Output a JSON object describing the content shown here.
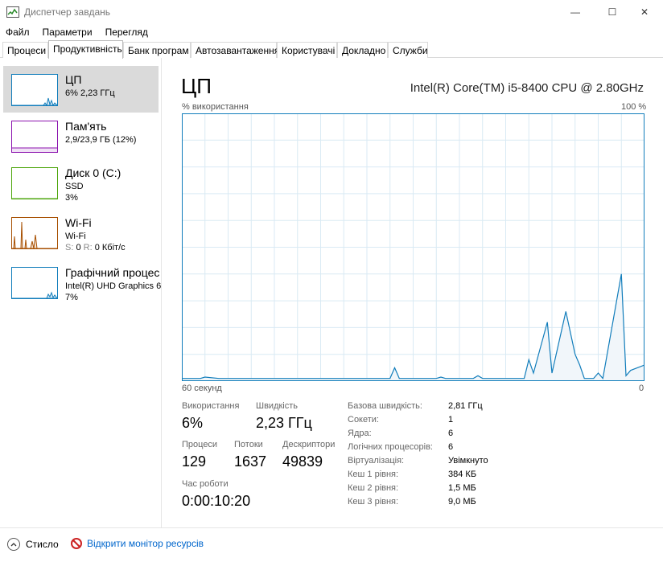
{
  "window": {
    "title": "Диспетчер завдань",
    "min_glyph": "—",
    "max_glyph": "☐",
    "close_glyph": "✕"
  },
  "menu": [
    "Файл",
    "Параметри",
    "Перегляд"
  ],
  "tabs": [
    "Процеси",
    "Продуктивність",
    "Банк програм",
    "Автозавантаження",
    "Користувачі",
    "Докладно",
    "Служби"
  ],
  "active_tab": "Продуктивність",
  "sidebar": {
    "items": [
      {
        "name": "cpu",
        "title": "ЦП",
        "sub1": "6% 2,23 ГГц",
        "sub2": "",
        "color": "#117dbb",
        "fill": "#f1f6fa"
      },
      {
        "name": "memory",
        "title": "Пам'ять",
        "sub1": "2,9/23,9 ГБ (12%)",
        "sub2": "",
        "color": "#8b12ae",
        "fill": "#f6eef9"
      },
      {
        "name": "disk",
        "title": "Диск 0 (C:)",
        "sub1": "SSD",
        "sub2": "3%",
        "color": "#4da60c",
        "fill": "#eff7e9"
      },
      {
        "name": "wifi",
        "title": "Wi-Fi",
        "sub1": "Wi-Fi",
        "sub2_s": "S:",
        "sub2_s_val": "0",
        "sub2_r": "R:",
        "sub2_r_val": "0 Кбіт/с",
        "color": "#a74f01",
        "fill": "#fcf3eb"
      },
      {
        "name": "gpu",
        "title": "Графічний процес",
        "sub1": "Intel(R) UHD Graphics 6",
        "sub2": "7%",
        "color": "#117dbb",
        "fill": "#f1f6fa"
      }
    ]
  },
  "main": {
    "title": "ЦП",
    "cpu_name": "Intel(R) Core(TM) i5-8400 CPU @ 2.80GHz",
    "y_label": "% використання",
    "y_max_label": "100 %",
    "x_left_label": "60 секунд",
    "x_right_label": "0"
  },
  "chart_data": {
    "type": "area",
    "ylim": [
      0,
      100
    ],
    "grid": true,
    "color": "#117dbb",
    "fill": "#f1f6fa",
    "series": [
      {
        "values": [
          0,
          0,
          0,
          0,
          0,
          0,
          0,
          0,
          0,
          0,
          0,
          0,
          0,
          0,
          0,
          0,
          0,
          0,
          0,
          0,
          0,
          0,
          0,
          0,
          0,
          0,
          0,
          0,
          0,
          0,
          0,
          0,
          0,
          0,
          0,
          0,
          0,
          0,
          0,
          0,
          0,
          0,
          0,
          0,
          0,
          0,
          0,
          0,
          0,
          0,
          0,
          0,
          0,
          0,
          0,
          0,
          0,
          0,
          0,
          0,
          0,
          0,
          0,
          0,
          0,
          0,
          0,
          0,
          0,
          0,
          0,
          0,
          0,
          0,
          0,
          0,
          0,
          0,
          0,
          0,
          0,
          0,
          0,
          0,
          0,
          0,
          0,
          0,
          0,
          0,
          0,
          0,
          0,
          0,
          0,
          0,
          0,
          0,
          0,
          0,
          0,
          0,
          0,
          0,
          0,
          0,
          0,
          0,
          0,
          0,
          0,
          0,
          0,
          0,
          0,
          0,
          0,
          0,
          0,
          0,
          0,
          0,
          0,
          0,
          0,
          0,
          0,
          0,
          0,
          0,
          0,
          0,
          0,
          0,
          0,
          0,
          0,
          0,
          0,
          0
        ]
      }
    ],
    "points": [
      [
        0,
        1
      ],
      [
        4,
        1
      ],
      [
        5,
        1.5
      ],
      [
        8,
        1
      ],
      [
        20,
        1
      ],
      [
        45,
        1
      ],
      [
        46,
        5
      ],
      [
        47,
        1
      ],
      [
        55,
        1
      ],
      [
        56,
        1.5
      ],
      [
        57,
        1
      ],
      [
        63,
        1
      ],
      [
        64,
        2
      ],
      [
        65,
        1
      ],
      [
        74,
        1
      ],
      [
        75,
        8
      ],
      [
        76,
        3
      ],
      [
        79,
        22
      ],
      [
        80,
        3
      ],
      [
        83,
        26
      ],
      [
        84,
        18
      ],
      [
        85,
        10
      ],
      [
        86,
        6
      ],
      [
        87,
        1
      ],
      [
        89,
        1
      ],
      [
        90,
        3
      ],
      [
        91,
        1
      ],
      [
        95,
        40
      ],
      [
        96,
        2
      ],
      [
        97,
        4
      ],
      [
        100,
        6
      ]
    ]
  },
  "stats": {
    "utilization_label": "Використання",
    "utilization_value": "6%",
    "speed_label": "Швидкість",
    "speed_value": "2,23 ГГц",
    "processes_label": "Процеси",
    "processes_value": "129",
    "threads_label": "Потоки",
    "threads_value": "1637",
    "handles_label": "Дескриптори",
    "handles_value": "49839",
    "uptime_label": "Час роботи",
    "uptime_value": "0:00:10:20"
  },
  "specs": [
    {
      "label": "Базова швидкість:",
      "value": "2,81 ГГц"
    },
    {
      "label": "Сокети:",
      "value": "1"
    },
    {
      "label": "Ядра:",
      "value": "6"
    },
    {
      "label": "Логічних процесорів:",
      "value": "6"
    },
    {
      "label": "Віртуалізація:",
      "value": "Увімкнуто"
    },
    {
      "label": "Кеш 1 рівня:",
      "value": "384 КБ"
    },
    {
      "label": "Кеш 2 рівня:",
      "value": "1,5 МБ"
    },
    {
      "label": "Кеш 3 рівня:",
      "value": "9,0 МБ"
    }
  ],
  "footer": {
    "fewer_details": "Стисло",
    "open_resmon": "Відкрити монітор ресурсів"
  }
}
